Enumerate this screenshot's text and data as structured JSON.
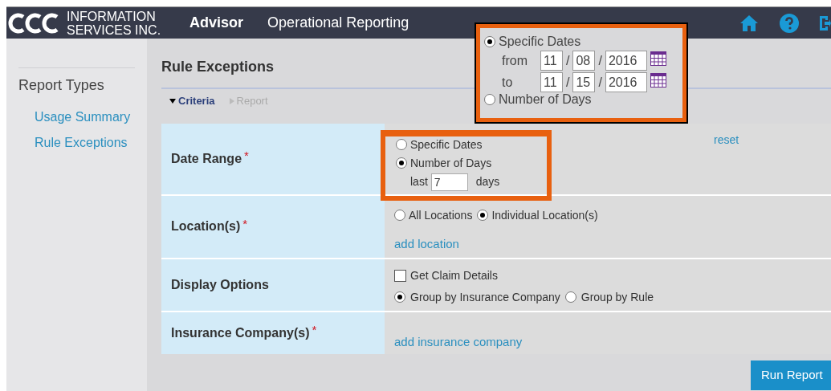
{
  "header": {
    "logo_line1": "INFORMATION",
    "logo_line2": "SERVICES INC.",
    "nav": [
      {
        "label": "Advisor",
        "selected": true
      },
      {
        "label": "Operational Reporting",
        "selected": false
      }
    ]
  },
  "sidebar": {
    "title": "Report Types",
    "items": [
      {
        "label": "Usage Summary"
      },
      {
        "label": "Rule Exceptions"
      }
    ]
  },
  "page_title": "Rule Exceptions",
  "subtabs": [
    {
      "label": "Criteria",
      "selected": true
    },
    {
      "label": "Report",
      "selected": false
    }
  ],
  "form": {
    "reset": "reset",
    "rows": [
      {
        "label": "Date Range",
        "required_mark": "*",
        "kind": "date_range",
        "options": [
          {
            "label": "Specific Dates",
            "selected": false
          },
          {
            "label": "Number of Days",
            "selected": true
          }
        ],
        "last_label": "last",
        "days_value": "7",
        "days_label": "days"
      },
      {
        "label": "Location(s)",
        "required_mark": "*",
        "kind": "locations",
        "options": [
          {
            "label": "All Locations",
            "selected": false
          },
          {
            "label": "Individual Location(s)",
            "selected": true
          }
        ],
        "link": "add location"
      },
      {
        "label": "Display Options",
        "kind": "display",
        "checkbox": {
          "label": "Get Claim Details",
          "checked": false
        },
        "options": [
          {
            "label": "Group by Insurance Company",
            "selected": true
          },
          {
            "label": "Group by Rule",
            "selected": false
          }
        ]
      },
      {
        "label": "Insurance Company(s)",
        "required_mark": "*",
        "kind": "link",
        "link": "add insurance company"
      }
    ]
  },
  "run_button": "Run Report",
  "callout": {
    "options": [
      {
        "label": "Specific Dates",
        "selected": true
      },
      {
        "label": "Number of Days",
        "selected": false
      }
    ],
    "dates": [
      {
        "label": "from",
        "month": "11",
        "day": "08",
        "year": "2016"
      },
      {
        "label": "to",
        "month": "11",
        "day": "15",
        "year": "2016"
      }
    ],
    "separator": "/"
  }
}
